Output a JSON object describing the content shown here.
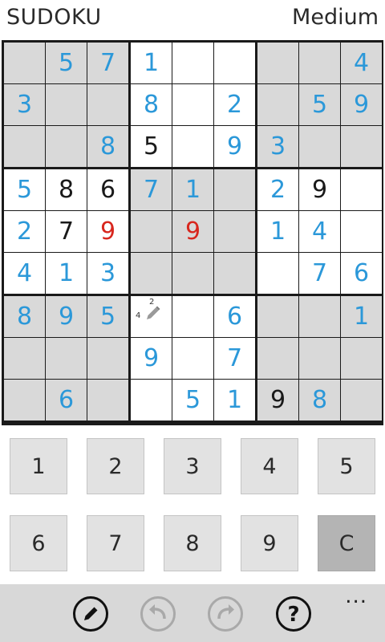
{
  "header": {
    "title": "SUDOKU",
    "difficulty": "Medium"
  },
  "board": {
    "cells": [
      [
        {
          "v": ""
        },
        {
          "v": "5",
          "t": "user"
        },
        {
          "v": "7",
          "t": "user"
        },
        {
          "v": "1",
          "t": "user"
        },
        {
          "v": ""
        },
        {
          "v": ""
        },
        {
          "v": ""
        },
        {
          "v": ""
        },
        {
          "v": "4",
          "t": "user"
        }
      ],
      [
        {
          "v": "3",
          "t": "user"
        },
        {
          "v": ""
        },
        {
          "v": ""
        },
        {
          "v": "8",
          "t": "user"
        },
        {
          "v": ""
        },
        {
          "v": "2",
          "t": "user"
        },
        {
          "v": ""
        },
        {
          "v": "5",
          "t": "user"
        },
        {
          "v": "9",
          "t": "user"
        }
      ],
      [
        {
          "v": ""
        },
        {
          "v": ""
        },
        {
          "v": "8",
          "t": "user"
        },
        {
          "v": "5",
          "t": "given"
        },
        {
          "v": ""
        },
        {
          "v": "9",
          "t": "user"
        },
        {
          "v": "3",
          "t": "user"
        },
        {
          "v": ""
        },
        {
          "v": ""
        }
      ],
      [
        {
          "v": "5",
          "t": "user"
        },
        {
          "v": "8",
          "t": "given"
        },
        {
          "v": "6",
          "t": "given"
        },
        {
          "v": "7",
          "t": "user"
        },
        {
          "v": "1",
          "t": "user"
        },
        {
          "v": ""
        },
        {
          "v": "2",
          "t": "user"
        },
        {
          "v": "9",
          "t": "given"
        },
        {
          "v": ""
        }
      ],
      [
        {
          "v": "2",
          "t": "user"
        },
        {
          "v": "7",
          "t": "given"
        },
        {
          "v": "9",
          "t": "error"
        },
        {
          "v": ""
        },
        {
          "v": "9",
          "t": "error"
        },
        {
          "v": ""
        },
        {
          "v": "1",
          "t": "user"
        },
        {
          "v": "4",
          "t": "user"
        },
        {
          "v": ""
        }
      ],
      [
        {
          "v": "4",
          "t": "user"
        },
        {
          "v": "1",
          "t": "user"
        },
        {
          "v": "3",
          "t": "user"
        },
        {
          "v": ""
        },
        {
          "v": ""
        },
        {
          "v": ""
        },
        {
          "v": ""
        },
        {
          "v": "7",
          "t": "user"
        },
        {
          "v": "6",
          "t": "user"
        }
      ],
      [
        {
          "v": "8",
          "t": "user"
        },
        {
          "v": "9",
          "t": "user"
        },
        {
          "v": "5",
          "t": "user"
        },
        {
          "v": "",
          "notes": [
            "2",
            "4"
          ],
          "pencil": true
        },
        {
          "v": ""
        },
        {
          "v": "6",
          "t": "user"
        },
        {
          "v": ""
        },
        {
          "v": ""
        },
        {
          "v": "1",
          "t": "user"
        }
      ],
      [
        {
          "v": ""
        },
        {
          "v": ""
        },
        {
          "v": ""
        },
        {
          "v": "9",
          "t": "user"
        },
        {
          "v": ""
        },
        {
          "v": "7",
          "t": "user"
        },
        {
          "v": ""
        },
        {
          "v": ""
        },
        {
          "v": ""
        }
      ],
      [
        {
          "v": ""
        },
        {
          "v": "6",
          "t": "user"
        },
        {
          "v": ""
        },
        {
          "v": ""
        },
        {
          "v": "5",
          "t": "user"
        },
        {
          "v": "1",
          "t": "user"
        },
        {
          "v": "9",
          "t": "given"
        },
        {
          "v": "8",
          "t": "user"
        },
        {
          "v": ""
        }
      ]
    ]
  },
  "keypad": {
    "keys": [
      "1",
      "2",
      "3",
      "4",
      "5",
      "6",
      "7",
      "8",
      "9",
      "C"
    ]
  },
  "appbar": {
    "icons": [
      "pencil-icon",
      "undo-icon",
      "redo-icon",
      "help-icon"
    ],
    "more": "..."
  },
  "colors": {
    "user_digit": "#2b98d9",
    "given_digit": "#1a1a1a",
    "error_digit": "#d8271e",
    "shaded_box": "#d9d9d9",
    "white_box": "#ffffff"
  }
}
